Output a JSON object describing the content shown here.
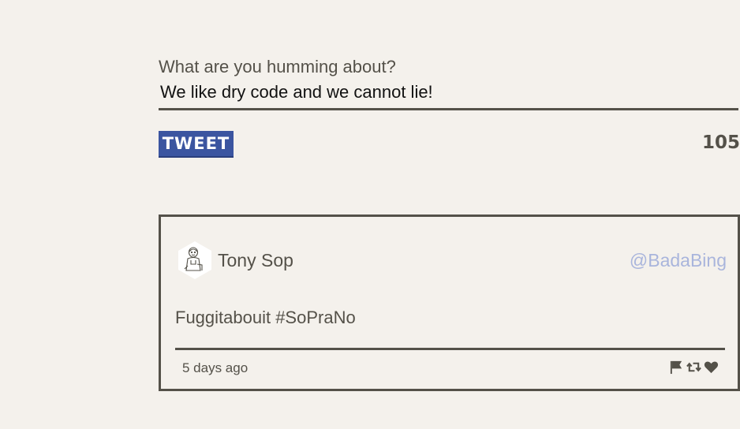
{
  "compose": {
    "label": "What are you humming about?",
    "value": "We like dry code and we cannot lie!",
    "button_label": "TWEET",
    "char_count": "105"
  },
  "tweet": {
    "author_name": "Tony Sop",
    "handle": "@BadaBing",
    "text": "Fuggitabouit #SoPraNo",
    "timestamp": "5 days ago",
    "actions": [
      "flag-icon",
      "retweet-icon",
      "heart-icon"
    ]
  },
  "colors": {
    "background": "#f4f1ec",
    "text": "#545149",
    "button": "#3b55a0",
    "handle": "#a9b5dc"
  }
}
